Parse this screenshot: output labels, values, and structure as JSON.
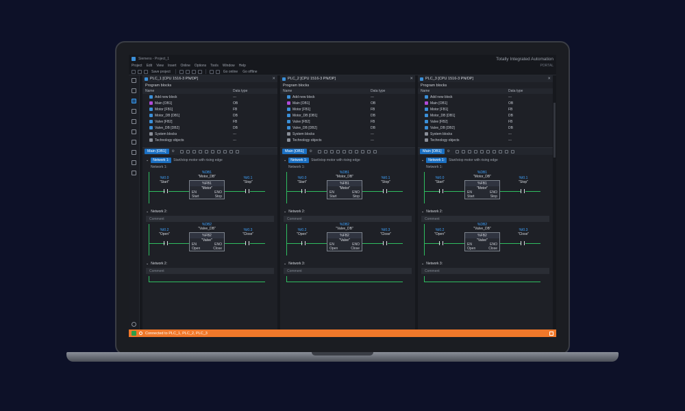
{
  "app": {
    "title_left": "Siemens - Project_1",
    "brand": "Totally Integrated Automation",
    "portal": "PORTAL"
  },
  "menu": [
    "Project",
    "Edit",
    "View",
    "Insert",
    "Online",
    "Options",
    "Tools",
    "Window",
    "Help"
  ],
  "toolbar": {
    "save_project": "Save project",
    "go_online": "Go online",
    "go_offline": "Go offline"
  },
  "panels": [
    {
      "plc": "PLC_1 [CPU 1516-3 PN/DP]",
      "network1_title": "Start/stop motor with rising edge",
      "network3_label": "Network 2:"
    },
    {
      "plc": "PLC_2 [CPU 1516-3 PN/DP]",
      "network1_title": "Start/stop motor with rising edge",
      "network3_label": "Network 3:"
    },
    {
      "plc": "PLC_3 [CPU 1516-3 PN/DP]",
      "network1_title": "Start/stop motor with rising edge",
      "network3_label": "Network 3:"
    }
  ],
  "program_blocks": {
    "title": "Program blocks",
    "col_name": "Name",
    "col_type": "Data type",
    "rows": [
      {
        "name": "Add new block",
        "type": "---",
        "color": "#3b8fd8"
      },
      {
        "name": "Main [OB1]",
        "type": "OB",
        "color": "#b04bd8"
      },
      {
        "name": "Motor [FB1]",
        "type": "FB",
        "color": "#3b8fd8"
      },
      {
        "name": "Motor_DB [DB1]",
        "type": "DB",
        "color": "#3b8fd8"
      },
      {
        "name": "Valve [FB2]",
        "type": "FB",
        "color": "#3b8fd8"
      },
      {
        "name": "Valve_DB [DB2]",
        "type": "DB",
        "color": "#3b8fd8"
      },
      {
        "name": "System blocks",
        "type": "---",
        "color": "#8a8f99"
      },
      {
        "name": "Technology objects",
        "type": "---",
        "color": "#8a8f99"
      }
    ]
  },
  "editor": {
    "tab": "Main [OB1]",
    "network1": "Network 1:",
    "network1_sub": "Network 1:",
    "network2": "Network 2:",
    "comment": "Comment"
  },
  "rung1": {
    "contact_addr": "%I0.0",
    "contact_tag": "\"Start\"",
    "db_addr": "%DB1",
    "db_name": "\"Motor_DB\"",
    "fb_addr": "%FB1",
    "fb_name": "\"Motor\"",
    "en": "EN",
    "eno": "ENO",
    "in_pin": "Start",
    "out_pin": "Stop",
    "coil_addr": "%I0.1",
    "coil_tag": "\"Stop\""
  },
  "rung2": {
    "contact_addr": "%I0.2",
    "contact_tag": "\"Open\"",
    "db_addr": "%DB2",
    "db_name": "\"Valve_DB\"",
    "fb_addr": "%FB2",
    "fb_name": "\"Valve\"",
    "en": "EN",
    "eno": "ENO",
    "in_pin": "Open",
    "out_pin": "Close",
    "coil_addr": "%I0.3",
    "coil_tag": "\"Close\""
  },
  "status": {
    "text": "Connected to PLC_1, PLC_2, PLC_3"
  }
}
